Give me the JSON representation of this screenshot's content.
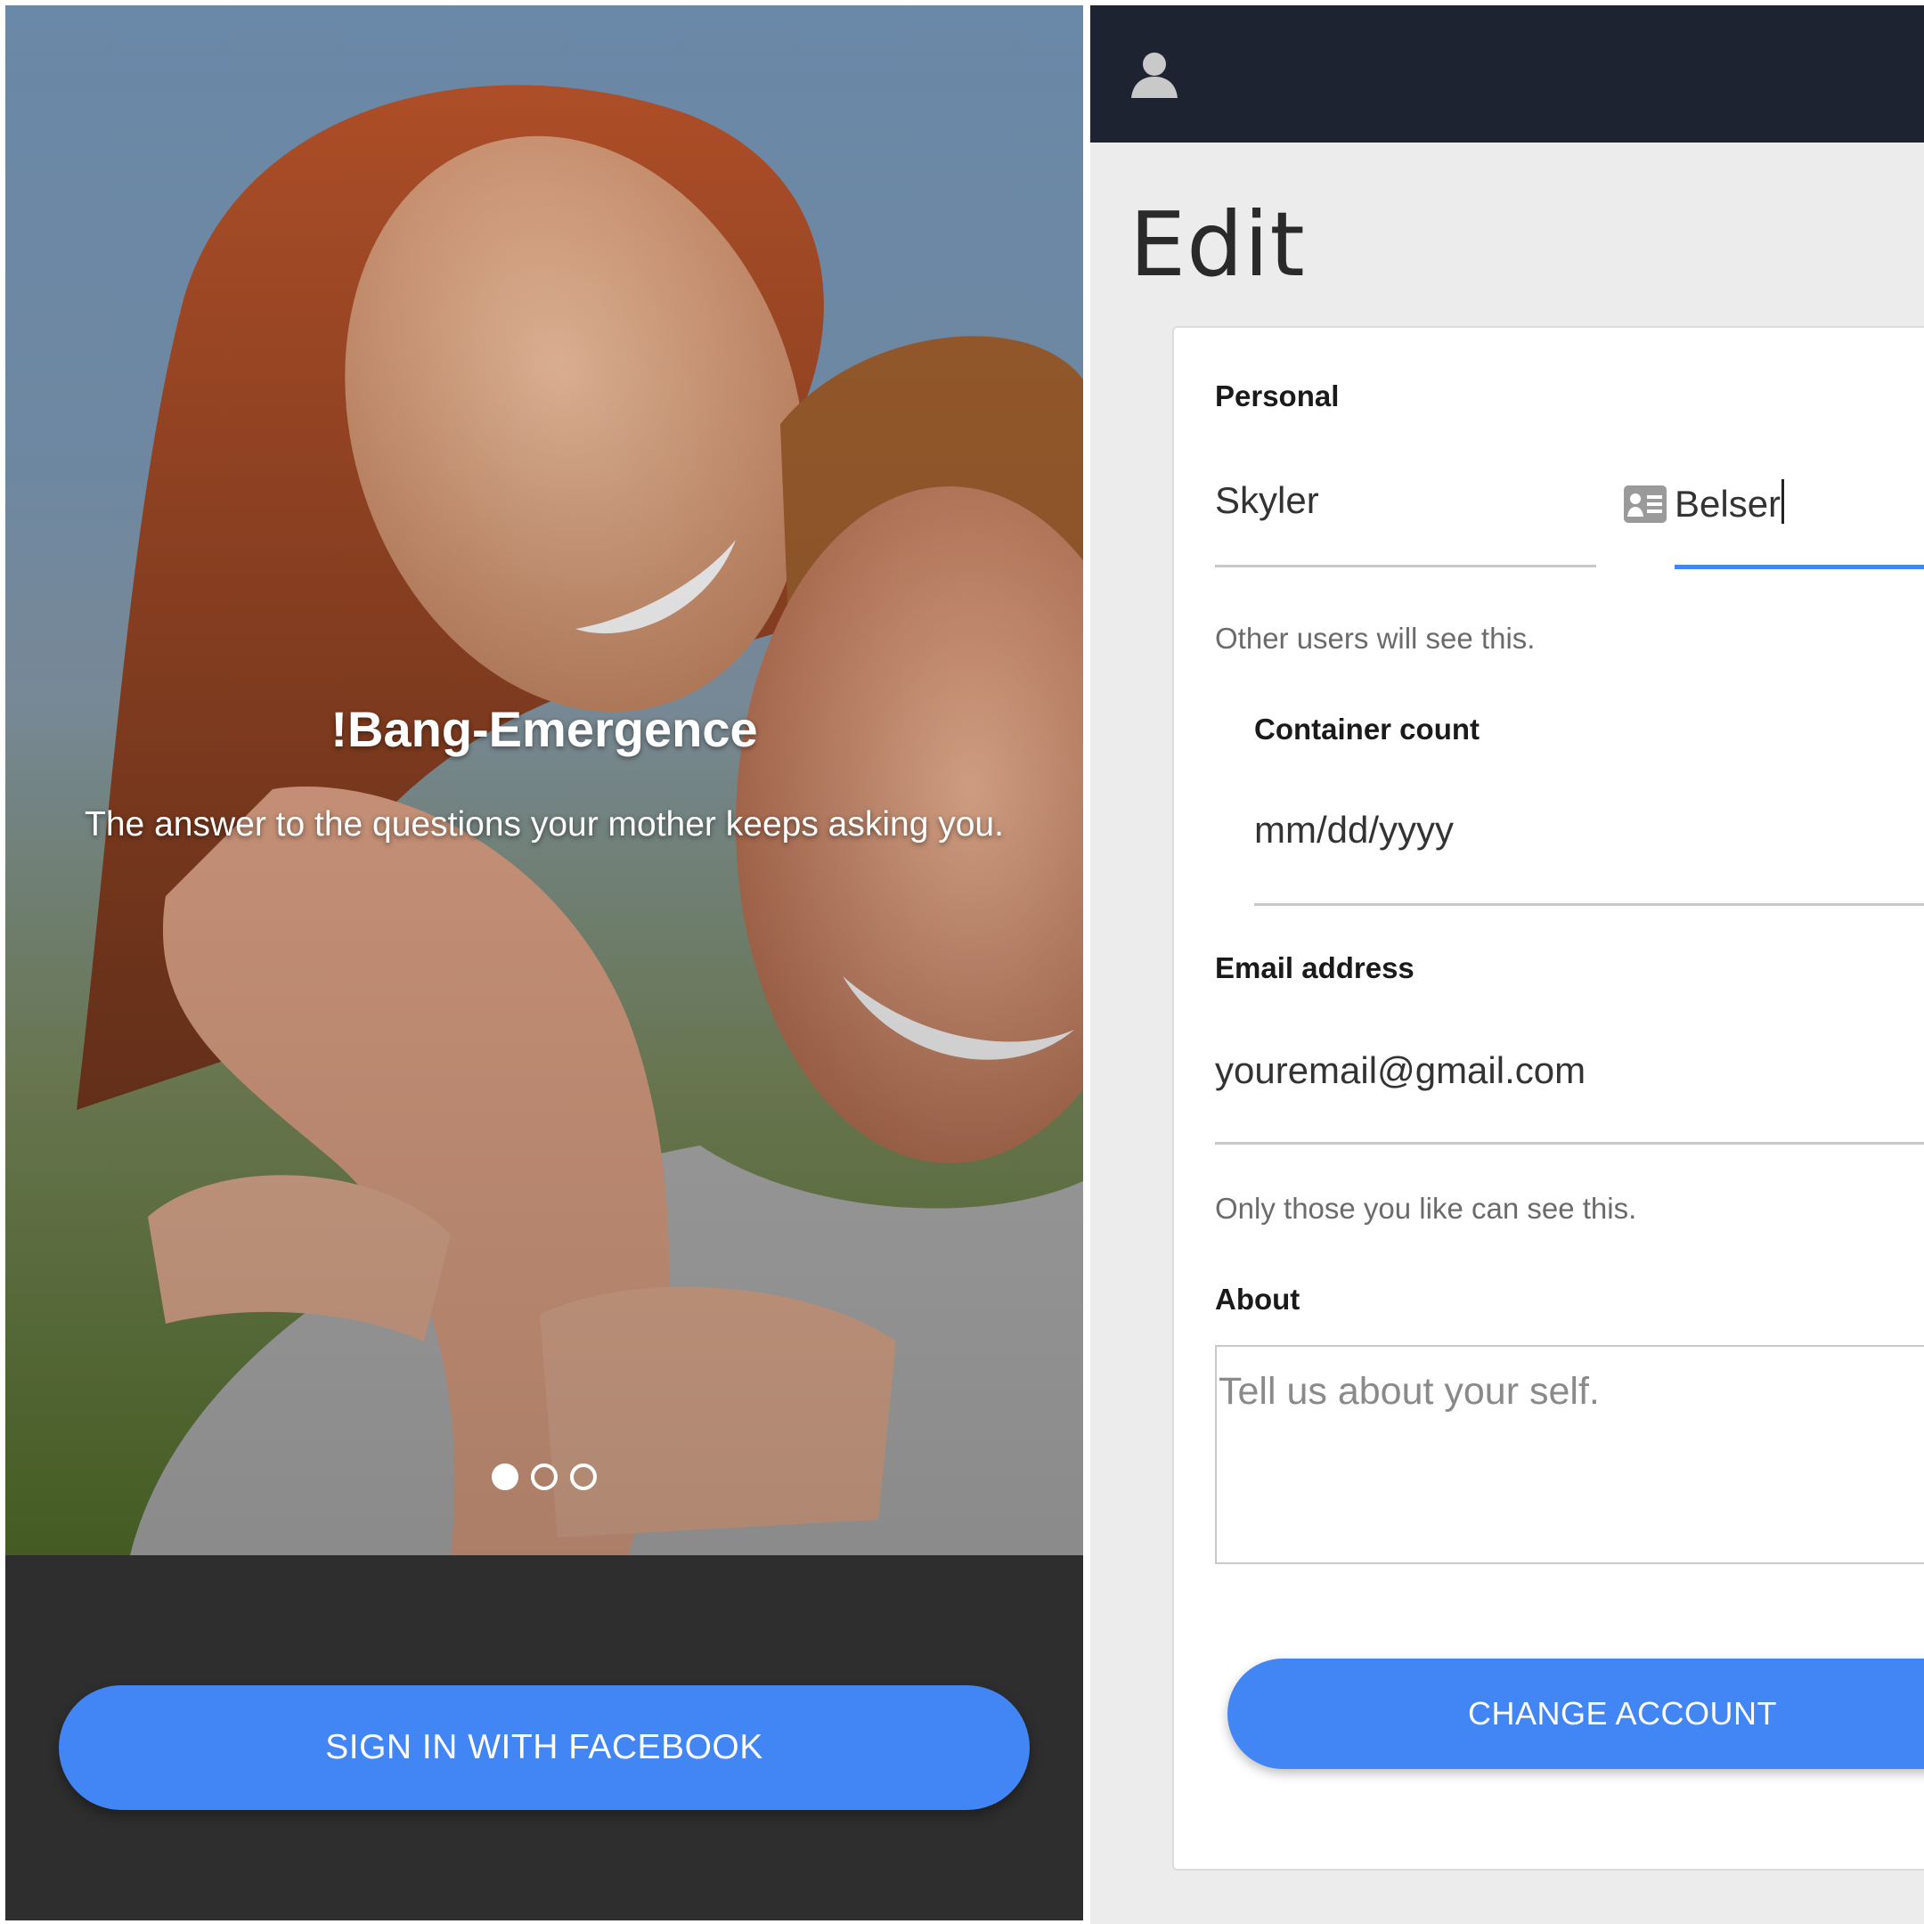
{
  "onboarding": {
    "app_name": "!Bang-Emergence",
    "tagline": "The answer to the questions your mother keeps asking you.",
    "carousel": {
      "pages": 3,
      "active": 1
    },
    "signin_label": "SIGN IN WITH FACEBOOK",
    "button_color": "#4285f4"
  },
  "edit": {
    "appbar_icon": "person-icon",
    "title": "Edit",
    "personal_label": "Personal",
    "first_name": "Skyler",
    "last_name": "Belser",
    "name_hint": "Other users will see this.",
    "container_count_label": "Container count",
    "date_placeholder": "mm/dd/yyyy",
    "email_label": "Email address",
    "email_value": "youremail@gmail.com",
    "email_hint": "Only those you like can see this.",
    "about_label": "About",
    "about_placeholder": "Tell us about your self.",
    "change_account_label": "CHANGE ACCOUNT",
    "accent_color": "#4285f4",
    "appbar_color": "#1d2331"
  }
}
